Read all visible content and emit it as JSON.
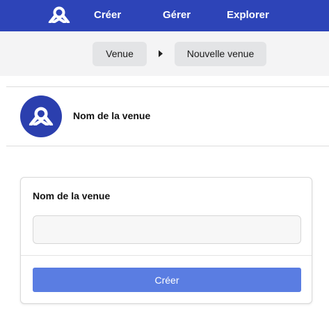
{
  "nav": {
    "logo_icon": "brand-logo-icon",
    "items": [
      "Créer",
      "Gérer",
      "Explorer"
    ]
  },
  "breadcrumb": {
    "items": [
      "Venue",
      "Nouvelle venue"
    ],
    "separator_icon": "caret-right-icon"
  },
  "venue": {
    "title": "Nom de la venue",
    "avatar_icon": "brand-logo-icon"
  },
  "form": {
    "label": "Nom de la venue",
    "input_value": "",
    "submit_label": "Créer"
  },
  "colors": {
    "nav_background": "#2d44b8",
    "avatar_background": "#2b3fae",
    "primary_button": "#5a7de2",
    "breadcrumb_bar": "#f4f4f5",
    "breadcrumb_pill": "#e3e4e6"
  }
}
